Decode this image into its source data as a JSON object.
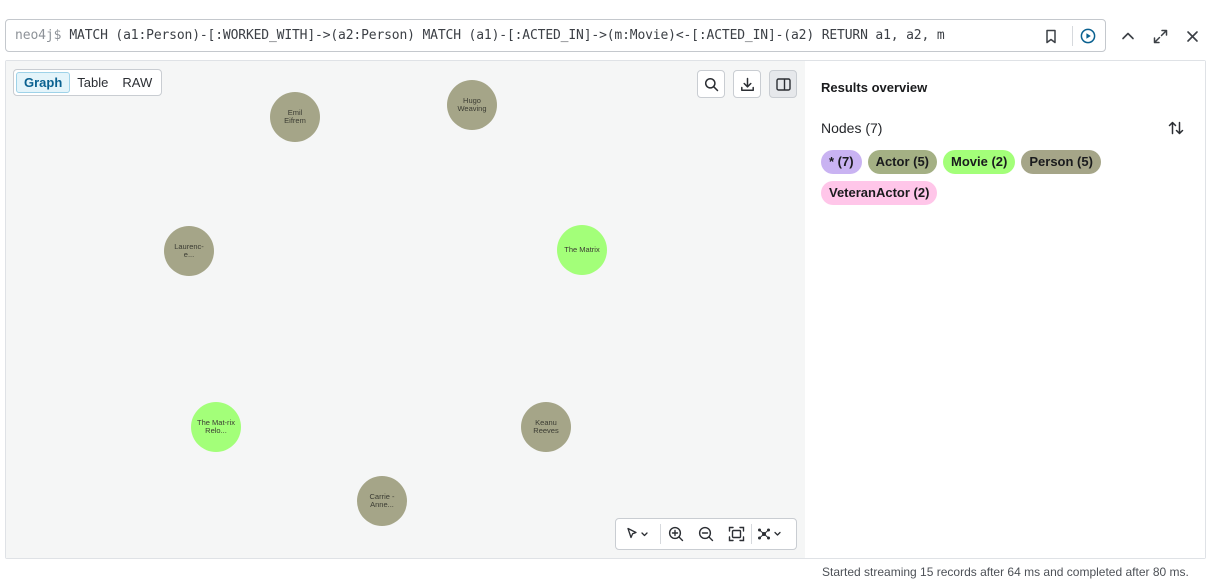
{
  "query": {
    "prompt": "neo4j$",
    "text": "MATCH (a1:Person)-[:WORKED_WITH]->(a2:Person) MATCH (a1)-[:ACTED_IN]->(m:Movie)<-[:ACTED_IN]-(a2) RETURN a1, a2, m"
  },
  "view_tabs": [
    {
      "label": "Graph",
      "active": true
    },
    {
      "label": "Table",
      "active": false
    },
    {
      "label": "RAW",
      "active": false
    }
  ],
  "nodes": [
    {
      "label": "Emil Eifrem",
      "kind": "person"
    },
    {
      "label": "Hugo Weaving",
      "kind": "person"
    },
    {
      "label": "Laurenc-e...",
      "kind": "person"
    },
    {
      "label": "The Matrix",
      "kind": "movie"
    },
    {
      "label": "The Mat-rix Relo...",
      "kind": "movie"
    },
    {
      "label": "Keanu Reeves",
      "kind": "person"
    },
    {
      "label": "Carrie -Anne...",
      "kind": "person"
    }
  ],
  "sidebar": {
    "title": "Results overview",
    "nodes_label": "Nodes (7)",
    "chips": [
      {
        "label": "* (7)",
        "color": "#c9b3f2"
      },
      {
        "label": "Actor (5)",
        "color": "#a4b084"
      },
      {
        "label": "Movie (2)",
        "color": "#a3ff79"
      },
      {
        "label": "Person (5)",
        "color": "#a5a588"
      },
      {
        "label": "VeteranActor (2)",
        "color": "#ffc6e9"
      }
    ]
  },
  "status": "Started streaming 15 records after 64 ms and completed after 80 ms."
}
